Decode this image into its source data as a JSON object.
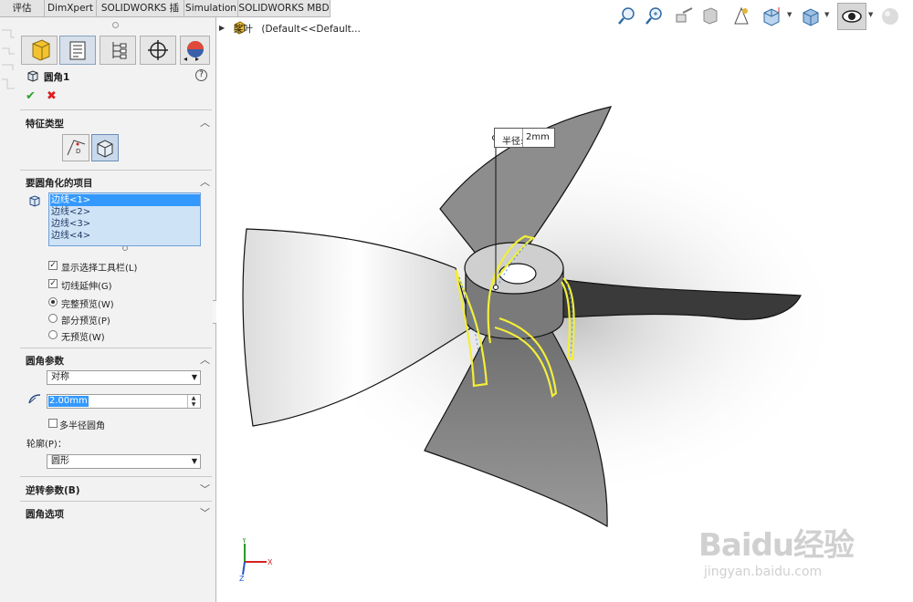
{
  "tabs": [
    "评估",
    "DimXpert",
    "SOLIDWORKS 插件",
    "Simulation",
    "SOLIDWORKS MBD"
  ],
  "breadcrumb": {
    "model": "桨叶",
    "config": "(Default<<Default..."
  },
  "feature": {
    "title": "圆角1",
    "help": "?"
  },
  "sections": {
    "feature_type": "特征类型",
    "items_to_fillet": "要圆角化的项目",
    "fillet_params": "圆角参数",
    "reverse_params": "逆转参数(B)",
    "fillet_options": "圆角选项"
  },
  "edges": [
    "边线<1>",
    "边线<2>",
    "边线<3>",
    "边线<4>"
  ],
  "options": {
    "show_toolbar": "显示选择工具栏(L)",
    "tangent_propagation": "切线延伸(G)",
    "full_preview": "完整预览(W)",
    "partial_preview": "部分预览(P)",
    "no_preview": "无预览(W)"
  },
  "params": {
    "symmetry": "对称",
    "radius": "2.00mm",
    "multi_radius": "多半径圆角",
    "profile_label": "轮廓(P)：",
    "profile": "圆形"
  },
  "callout": {
    "label": "半径:",
    "value": "2mm"
  },
  "triad": {
    "x": "X",
    "y": "Y",
    "z": "Z"
  },
  "watermark": {
    "main": "Baidu经验",
    "sub": "jingyan.baidu.com"
  },
  "colors": {
    "accent": "#3399ff",
    "selection": "#f2ee3a",
    "model": "#8f8f8f"
  }
}
